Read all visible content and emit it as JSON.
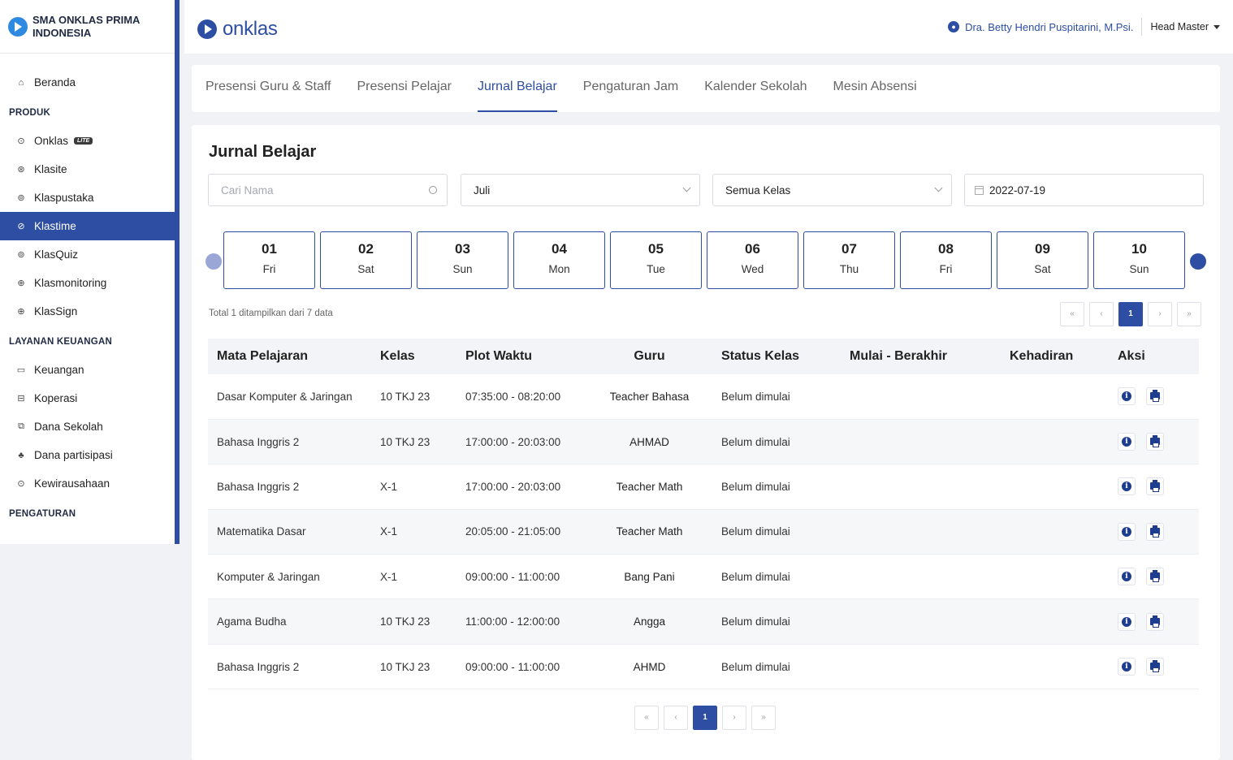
{
  "sidebar": {
    "school": "SMA ONKLAS PRIMA INDONESIA",
    "home": {
      "label": "Beranda",
      "icon": "home-icon"
    },
    "sections": [
      {
        "title": "PRODUK",
        "items": [
          {
            "label": "Onklas",
            "badge": "LITE",
            "icon": "onklas-icon"
          },
          {
            "label": "Klasite",
            "icon": "klasite-icon"
          },
          {
            "label": "Klaspustaka",
            "icon": "klaspustaka-icon"
          },
          {
            "label": "Klastime",
            "icon": "klastime-icon",
            "active": true
          },
          {
            "label": "KlasQuiz",
            "icon": "klasquiz-icon"
          },
          {
            "label": "Klasmonitoring",
            "icon": "klasmonitoring-icon"
          },
          {
            "label": "KlasSign",
            "icon": "klassign-icon"
          }
        ]
      },
      {
        "title": "LAYANAN KEUANGAN",
        "items": [
          {
            "label": "Keuangan",
            "icon": "wallet-icon"
          },
          {
            "label": "Koperasi",
            "icon": "store-icon"
          },
          {
            "label": "Dana Sekolah",
            "icon": "money-icon"
          },
          {
            "label": "Dana partisipasi",
            "icon": "hand-money-icon"
          },
          {
            "label": "Kewirausahaan",
            "icon": "coin-icon"
          }
        ]
      },
      {
        "title": "PENGATURAN",
        "items": []
      }
    ]
  },
  "topbar": {
    "brand": "onklas",
    "user_name": "Dra. Betty Hendri Puspitarini, M.Psi.",
    "user_role": "Head Master"
  },
  "tabs": [
    "Presensi Guru & Staff",
    "Presensi Pelajar",
    "Jurnal Belajar",
    "Pengaturan Jam",
    "Kalender Sekolah",
    "Mesin Absensi"
  ],
  "active_tab": "Jurnal Belajar",
  "main": {
    "title": "Jurnal Belajar",
    "search_placeholder": "Cari Nama",
    "month": "Juli",
    "class_filter": "Semua Kelas",
    "date": "2022-07-19",
    "total_text": "Total 1 ditampilkan dari 7 data",
    "current_page": "1"
  },
  "days": [
    {
      "num": "01",
      "name": "Fri"
    },
    {
      "num": "02",
      "name": "Sat"
    },
    {
      "num": "03",
      "name": "Sun"
    },
    {
      "num": "04",
      "name": "Mon"
    },
    {
      "num": "05",
      "name": "Tue"
    },
    {
      "num": "06",
      "name": "Wed"
    },
    {
      "num": "07",
      "name": "Thu"
    },
    {
      "num": "08",
      "name": "Fri"
    },
    {
      "num": "09",
      "name": "Sat"
    },
    {
      "num": "10",
      "name": "Sun"
    }
  ],
  "pager_labels": [
    "«",
    "‹",
    "1",
    "›",
    "»"
  ],
  "table": {
    "headers": [
      "Mata Pelajaran",
      "Kelas",
      "Plot Waktu",
      "Guru",
      "Status Kelas",
      "Mulai - Berakhir",
      "Kehadiran",
      "Aksi"
    ],
    "rows": [
      {
        "mapel": "Dasar Komputer & Jaringan",
        "kelas": "10 TKJ 23",
        "waktu": "07:35:00 - 08:20:00",
        "guru": "Teacher Bahasa",
        "status": "Belum dimulai",
        "mulai": "",
        "hadir": ""
      },
      {
        "mapel": "Bahasa Inggris 2",
        "kelas": "10 TKJ 23",
        "waktu": "17:00:00 - 20:03:00",
        "guru": "AHMAD",
        "status": "Belum dimulai",
        "mulai": "",
        "hadir": ""
      },
      {
        "mapel": "Bahasa Inggris 2",
        "kelas": "X-1",
        "waktu": "17:00:00 - 20:03:00",
        "guru": "Teacher Math",
        "status": "Belum dimulai",
        "mulai": "",
        "hadir": ""
      },
      {
        "mapel": "Matematika Dasar",
        "kelas": "X-1",
        "waktu": "20:05:00 - 21:05:00",
        "guru": "Teacher Math",
        "status": "Belum dimulai",
        "mulai": "",
        "hadir": ""
      },
      {
        "mapel": "Komputer & Jaringan",
        "kelas": "X-1",
        "waktu": "09:00:00 - 11:00:00",
        "guru": "Bang Pani",
        "status": "Belum dimulai",
        "mulai": "",
        "hadir": ""
      },
      {
        "mapel": "Agama Budha",
        "kelas": "10 TKJ 23",
        "waktu": "11:00:00 - 12:00:00",
        "guru": "Angga",
        "status": "Belum dimulai",
        "mulai": "",
        "hadir": ""
      },
      {
        "mapel": "Bahasa Inggris 2",
        "kelas": "10 TKJ 23",
        "waktu": "09:00:00 - 11:00:00",
        "guru": "AHMD",
        "status": "Belum dimulai",
        "mulai": "",
        "hadir": ""
      }
    ]
  },
  "colors": {
    "primary": "#2d4ea3",
    "accent": "#2d8ae0"
  }
}
